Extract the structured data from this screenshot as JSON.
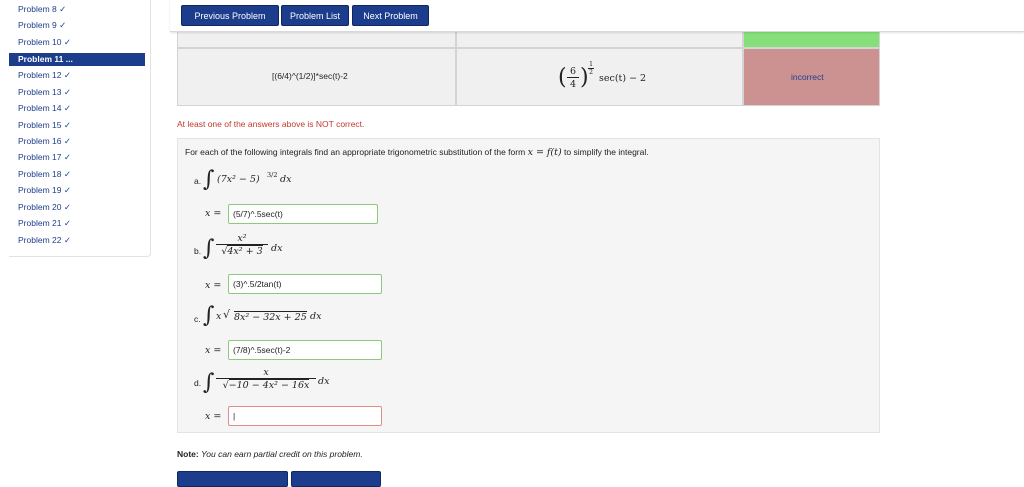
{
  "sidebar": {
    "items": [
      {
        "label": "Problem 8 ✓"
      },
      {
        "label": "Problem 9 ✓"
      },
      {
        "label": "Problem 10 ✓"
      },
      {
        "label": "Problem 11 ..."
      },
      {
        "label": "Problem 12 ✓"
      },
      {
        "label": "Problem 13 ✓"
      },
      {
        "label": "Problem 14 ✓"
      },
      {
        "label": "Problem 15 ✓"
      },
      {
        "label": "Problem 16 ✓"
      },
      {
        "label": "Problem 17 ✓"
      },
      {
        "label": "Problem 18 ✓"
      },
      {
        "label": "Problem 19 ✓"
      },
      {
        "label": "Problem 20 ✓"
      },
      {
        "label": "Problem 21 ✓"
      },
      {
        "label": "Problem 22 ✓"
      }
    ]
  },
  "nav": {
    "previous": "Previous Problem",
    "list": "Problem List",
    "next": "Next Problem"
  },
  "results": {
    "entered": "[(6/4)^(1/2)]*sec(t)-2",
    "preview_frac_num": "6",
    "preview_frac_den": "4",
    "preview_exp_num": "1",
    "preview_exp_den": "2",
    "preview_tail": "sec(t) − 2",
    "status": "incorrect",
    "colors": {
      "correct": "#85e07a",
      "incorrect": "#cc9292"
    }
  },
  "feedback": "At least one of the answers above is NOT correct.",
  "problem": {
    "intro_before": "For each of the following integrals find an appropriate trigonometric substitution of the form",
    "intro_math": "x = f(t)",
    "intro_after": "to simplify the integral.",
    "x_eq": "x =",
    "parts": [
      {
        "letter": "a.",
        "integrand": "(7x² − 5)",
        "exponent": "3/2",
        "dx": "dx",
        "answer": "(5/7)^.5sec(t)"
      },
      {
        "letter": "b.",
        "numerator": "x²",
        "denominator": "4x² + 3",
        "dx": "dx",
        "answer": "(3)^.5/2tan(t)"
      },
      {
        "letter": "c.",
        "prefix": "x",
        "radicand": "8x² − 32x + 25",
        "dx": "dx",
        "answer": "(7/8)^.5sec(t)-2"
      },
      {
        "letter": "d.",
        "numerator": "x",
        "denominator": "−10 − 4x² − 16x",
        "dx": "dx",
        "answer": ""
      }
    ]
  },
  "note_label": "Note:",
  "note_text": "You can earn partial credit on this problem."
}
